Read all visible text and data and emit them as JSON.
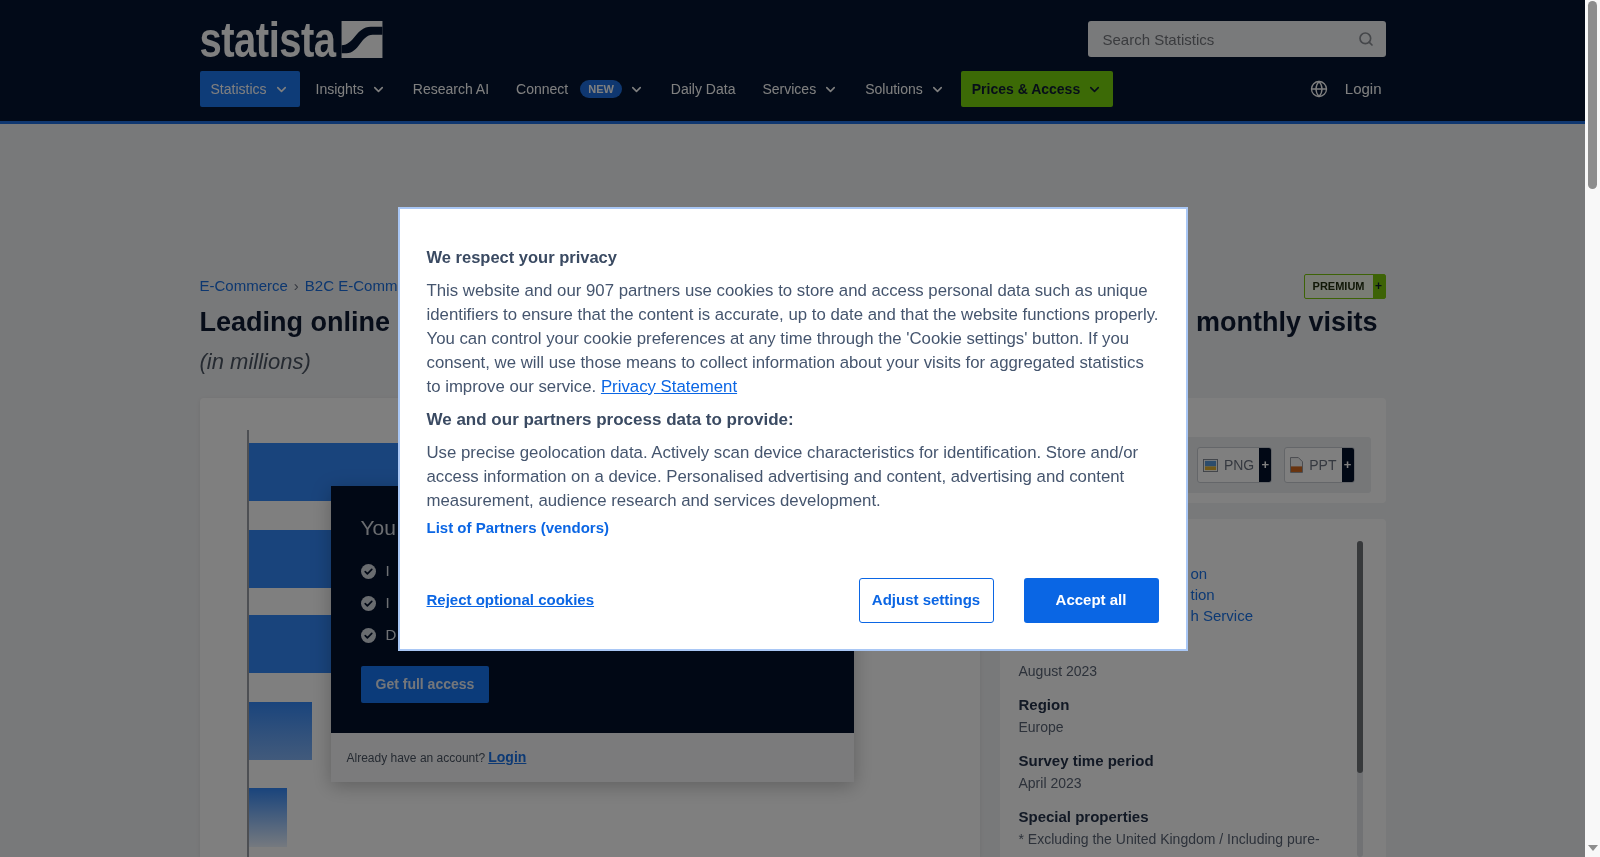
{
  "header": {
    "logo": "statista",
    "search": {
      "placeholder": "Search Statistics"
    },
    "nav": [
      {
        "label": "Statistics",
        "kind": "menu",
        "selected": true
      },
      {
        "label": "Insights",
        "kind": "menu",
        "selected": false
      },
      {
        "label": "Research AI",
        "kind": "link",
        "selected": false
      },
      {
        "label": "Connect",
        "kind": "menu",
        "badge": "NEW",
        "selected": false
      },
      {
        "label": "Daily Data",
        "kind": "link",
        "selected": false
      },
      {
        "label": "Services",
        "kind": "menu",
        "selected": false
      },
      {
        "label": "Solutions",
        "kind": "menu",
        "selected": false
      },
      {
        "label": "Prices & Access",
        "kind": "cta",
        "selected": false
      }
    ],
    "login": "Login"
  },
  "breadcrumb": {
    "items": [
      "E-Commerce",
      "B2C E-Comm"
    ],
    "separator": "›"
  },
  "premium_badge": {
    "label": "PREMIUM",
    "plus": "+"
  },
  "title": {
    "start": "Leading online",
    "end": "monthly visits",
    "unit": "(in millions)"
  },
  "paywall": {
    "title": "You",
    "features": [
      "I",
      "I",
      "D"
    ],
    "button": "Get full access",
    "footer_text": "Already have an account?",
    "footer_link": "Login"
  },
  "downloads": [
    {
      "label": "PNG",
      "kind": "image",
      "plus": "+"
    },
    {
      "label": "PPT",
      "kind": "slides",
      "plus": "+"
    }
  ],
  "details": {
    "links": [
      "on",
      "tion",
      "h Service"
    ],
    "fields": [
      {
        "value": "August 2023"
      },
      {
        "label": "Region",
        "value": "Europe"
      },
      {
        "label": "Survey time period",
        "value": "April 2023"
      },
      {
        "label": "Special properties",
        "value": "* Excluding the United Kingdom / Including pure-"
      }
    ]
  },
  "cookie_dialog": {
    "title": "We respect your privacy",
    "text": "This website and our 907 partners use cookies to store and access personal data such as unique identifiers to ensure that the content is accurate, up to date and that the website functions properly. You can control your cookie preferences at any time through the 'Cookie settings' button. If you consent, we will use those means to collect information about your visits for aggregated statistics to improve our service.",
    "privacy_link": "Privacy Statement",
    "purposes_title": "We and our partners process data to provide:",
    "purposes": "Use precise geolocation data. Actively scan device characteristics for identification. Store and/or access information on a device. Personalised advertising and content, advertising and content measurement, audience research and services development.",
    "partners_link": "List of Partners (vendors)",
    "reject": "Reject optional cookies",
    "adjust": "Adjust settings",
    "accept": "Accept all"
  }
}
